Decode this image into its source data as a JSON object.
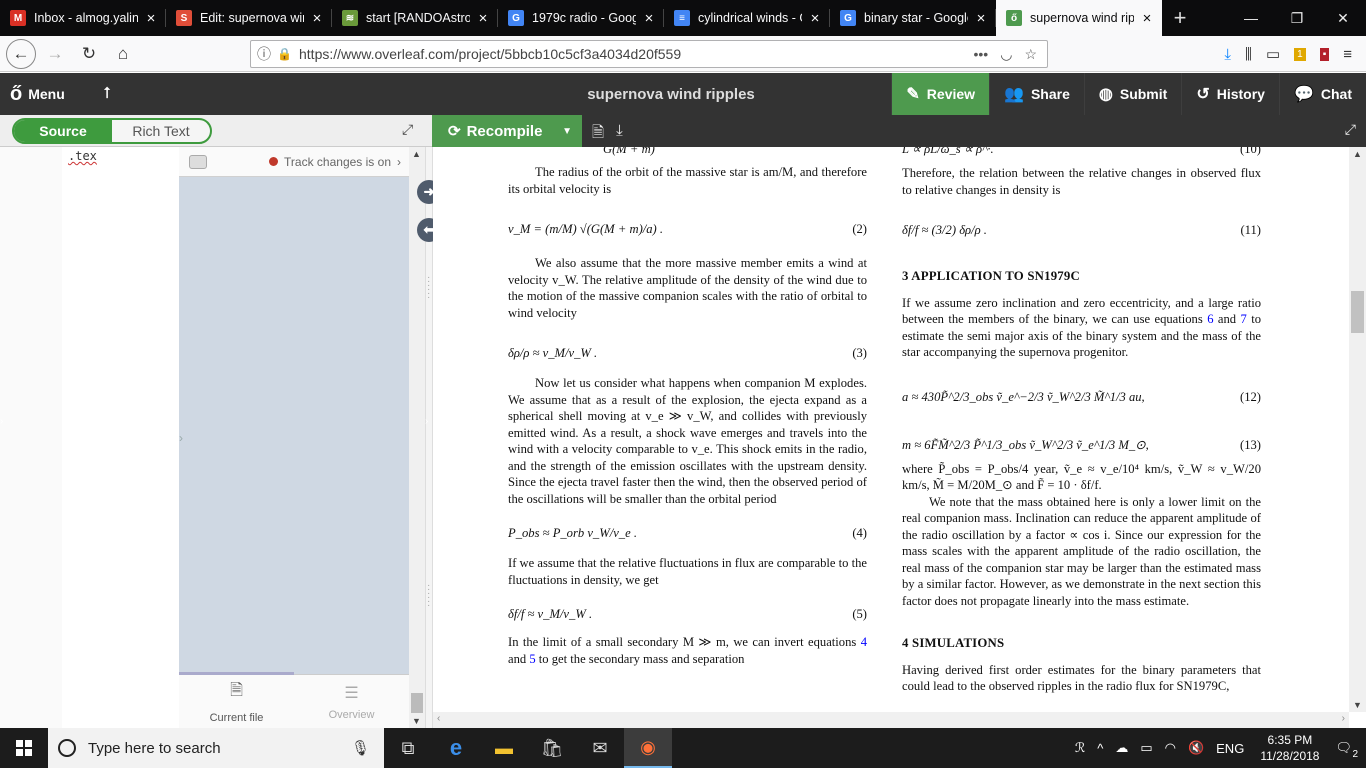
{
  "browser": {
    "tabs": [
      {
        "title": "Inbox - almog.yalin",
        "icon": "gmail-icon",
        "color": "#d93025",
        "glyph": "M"
      },
      {
        "title": "Edit: supernova win",
        "icon": "s-icon",
        "color": "#e04e39",
        "glyph": "S"
      },
      {
        "title": "start [RANDOAstro]",
        "icon": "wiki-icon",
        "color": "#6a9a3a",
        "glyph": "≋"
      },
      {
        "title": "1979c radio - Googl",
        "icon": "google-icon",
        "color": "#4285f4",
        "glyph": "G"
      },
      {
        "title": "cylindrical winds - G",
        "icon": "docs-icon",
        "color": "#4285f4",
        "glyph": "≡"
      },
      {
        "title": "binary star - Google",
        "icon": "google-icon",
        "color": "#4285f4",
        "glyph": "G"
      },
      {
        "title": "supernova wind ripp",
        "icon": "overleaf-icon",
        "color": "#4e9a4e",
        "glyph": "ő"
      }
    ],
    "url": "https://www.overleaf.com/project/5bbcb10c5cf3a4034d20f559"
  },
  "overleaf": {
    "menu_label": "Menu",
    "project_title": "supernova wind ripples",
    "review_label": "Review",
    "share_label": "Share",
    "submit_label": "Submit",
    "history_label": "History",
    "chat_label": "Chat",
    "source_label": "Source",
    "richtext_label": "Rich Text",
    "recompile_label": "Recompile",
    "file_name": ".tex",
    "track_changes": "Track changes is on",
    "current_file_label": "Current file",
    "overview_label": "Overview"
  },
  "paper": {
    "left": {
      "top_frag": "G(M + m)",
      "p1": "The radius of the orbit of the massive star is am/M, and therefore its orbital velocity is",
      "eq2": "v_M = (m/M) √(G(M + m)/a) .",
      "eq2_num": "(2)",
      "p2": "We also assume that the more massive member emits a wind at velocity v_W. The relative amplitude of the density of the wind due to the motion of the massive companion scales with the ratio of orbital to wind velocity",
      "eq3": "δρ/ρ ≈ v_M/v_W .",
      "eq3_num": "(3)",
      "p3": "Now let us consider what happens when companion M explodes. We assume that as a result of the explosion, the ejecta expand as a spherical shell moving at v_e ≫ v_W, and collides with previously emitted wind. As a result, a shock wave emerges and travels into the wind with a velocity comparable to v_e. This shock emits in the radio, and the strength of the emission oscillates with the upstream density. Since the ejecta travel faster then the wind, then the observed period of the oscillations will be smaller than the orbital period",
      "eq4": "P_obs ≈ P_orb v_W/v_e .",
      "eq4_num": "(4)",
      "p4": "If we assume that the relative fluctuations in flux are comparable to the fluctuations in density, we get",
      "eq5": "δf/f ≈ v_M/v_W .",
      "eq5_num": "(5)",
      "p5a": "In the limit of a small secondary M ≫ m, we can invert equations",
      "ref4": "4",
      "and": "and",
      "ref5": "5",
      "p5b": "to get the secondary mass and separation"
    },
    "right": {
      "top_frag": "L ∝ ρL/ω_s ∝ ρ^·.",
      "top_num": "(10)",
      "p1": "Therefore, the relation between the relative changes in observed flux to relative changes in density is",
      "eq11": "δf/f ≈ (3/2) δρ/ρ .",
      "eq11_num": "(11)",
      "h3": "3   APPLICATION TO SN1979C",
      "p2a": "If we assume zero inclination and zero eccentricity, and a large ratio between the members of the binary, we can use equations",
      "ref6": "6",
      "ref7": "7",
      "p2b": "to estimate the semi major axis of the binary system and the mass of the star accompanying the supernova progenitor.",
      "eq12": "a ≈ 430P̃^2/3_obs ṽ_e^−2/3 ṽ_W^2/3 M̃^1/3 au,",
      "eq12_num": "(12)",
      "eq13": "m ≈ 6F̃M̃^2/3 P̃^1/3_obs ṽ_W^2/3 ṽ_e^1/3 M_⊙,",
      "eq13_num": "(13)",
      "p3": "where P̃_obs = P_obs/4 year, ṽ_e ≈ v_e/10⁴ km/s, ṽ_W ≈ v_W/20 km/s, M̃ = M/20M_⊙ and F̃ = 10 · δf/f.",
      "p4": "We note that the mass obtained here is only a lower limit on the real companion mass. Inclination can reduce the apparent amplitude of the radio oscillation by a factor ∝ cos i. Since our expression for the mass scales with the apparent amplitude of the radio oscillation, the real mass of the companion star may be larger than the estimated mass by a similar factor. However, as we demonstrate in the next section this factor does not propagate linearly into the mass estimate.",
      "h4": "4   SIMULATIONS",
      "p5": "Having derived first order estimates for the binary parameters that could lead to the observed ripples in the radio flux for SN1979C,"
    }
  },
  "taskbar": {
    "search_placeholder": "Type here to search",
    "lang": "ENG",
    "time": "6:35 PM",
    "date": "11/28/2018",
    "notif_count": "2"
  }
}
